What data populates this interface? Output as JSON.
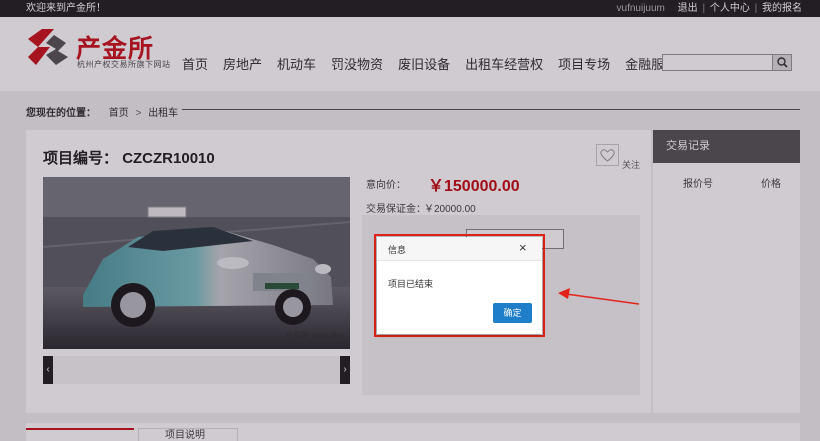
{
  "topbar": {
    "welcome": "欢迎来到产金所！",
    "user": "vufnuijuum",
    "logout": "退出",
    "user_center": "个人中心",
    "my_signup": "我的报名",
    "separator": "|"
  },
  "header": {
    "logo_name": "产金所",
    "logo_sub": "杭州产权交易所旗下网站",
    "nav": [
      "首页",
      "房地产",
      "机动车",
      "罚没物资",
      "废旧设备",
      "出租车经营权",
      "项目专场",
      "金融服务"
    ],
    "search_placeholder": ""
  },
  "breadcrumb": {
    "label": "您现在的位置：",
    "items": [
      "首页",
      "出租车"
    ],
    "separator": ">"
  },
  "project": {
    "label": "项目编号：",
    "code": "CZCZR10010",
    "follow": "关注",
    "price_label": "意向价：",
    "price": "￥150000.00",
    "deposit_label": "交易保证金：",
    "deposit": "￥20000.00",
    "photo_watermark": "易车网 www.bita"
  },
  "side": {
    "title": "交易记录",
    "col_bid_no": "报价号",
    "col_price": "价格"
  },
  "bottom": {
    "tab2": "项目说明"
  },
  "modal": {
    "title": "信息",
    "close": "×",
    "message": "项目已结束",
    "ok": "确定"
  },
  "colors": {
    "brand_red": "#c9151e",
    "price_red": "#c30d12",
    "ok_blue": "#1e7ec9",
    "highlight": "#e2231a"
  }
}
